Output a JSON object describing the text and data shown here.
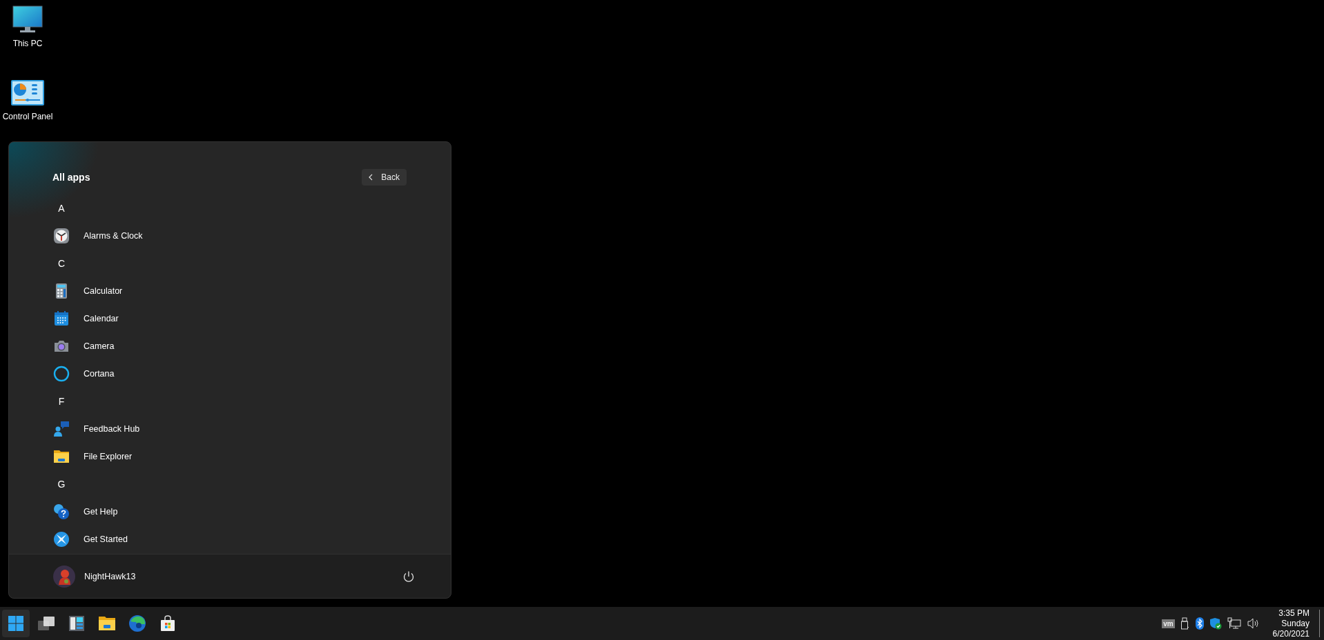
{
  "desktop_icons": [
    {
      "label": "This PC",
      "kind": "pc"
    },
    {
      "label": "Control Panel",
      "kind": "control"
    }
  ],
  "start_menu": {
    "title": "All apps",
    "back_button": "Back",
    "groups": [
      {
        "letter": "A",
        "apps": [
          {
            "name": "Alarms & Clock",
            "kind": "clock"
          }
        ]
      },
      {
        "letter": "C",
        "apps": [
          {
            "name": "Calculator",
            "kind": "calculator"
          },
          {
            "name": "Calendar",
            "kind": "calendar"
          },
          {
            "name": "Camera",
            "kind": "camera"
          },
          {
            "name": "Cortana",
            "kind": "ring"
          }
        ]
      },
      {
        "letter": "F",
        "apps": [
          {
            "name": "Feedback Hub",
            "kind": "feedback"
          },
          {
            "name": "File Explorer",
            "kind": "folder"
          }
        ]
      },
      {
        "letter": "G",
        "apps": [
          {
            "name": "Get Help",
            "kind": "help"
          },
          {
            "name": "Get Started",
            "kind": "started"
          }
        ]
      }
    ],
    "user": {
      "name": "NightHawk13"
    }
  },
  "taskbar": {
    "start_button": {
      "selected": true
    },
    "tray": {
      "vm_label": "vm"
    },
    "clock": {
      "time": "3:35 PM",
      "day": "Sunday",
      "date": "6/20/2021"
    }
  }
}
